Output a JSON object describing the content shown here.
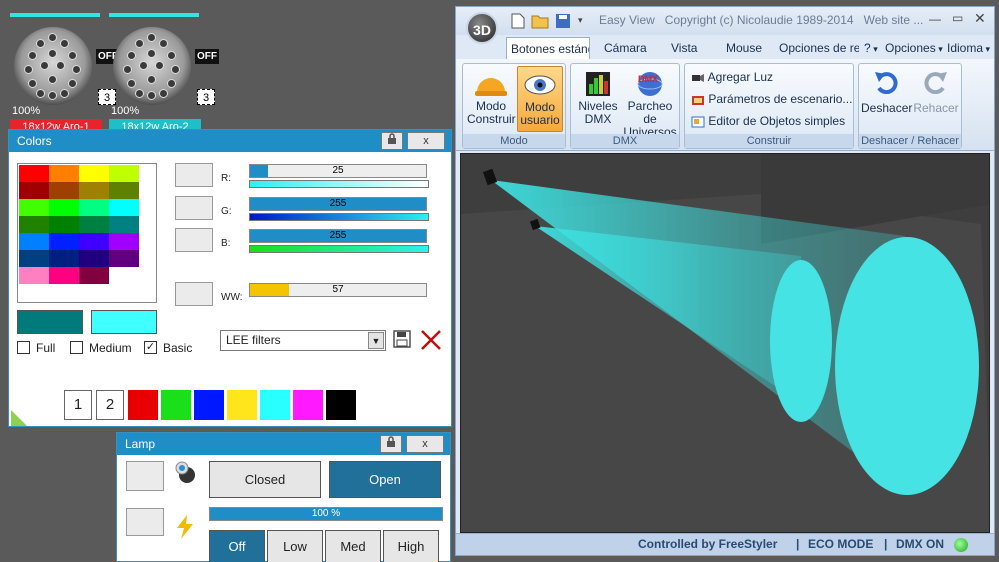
{
  "fixtures": [
    {
      "intensity": "100%",
      "off_label": "OFF",
      "number": "3",
      "name": "18x12w Aro-1",
      "name_color": "#e8232c"
    },
    {
      "intensity": "100%",
      "off_label": "OFF",
      "number": "3",
      "name": "18x12w Aro-2",
      "name_color": "#1fbfc9"
    }
  ],
  "colors_panel": {
    "title": "Colors",
    "lock_icon": "lock-icon",
    "close_label": "x",
    "palette": [
      [
        "#ff0000",
        "#ff8000",
        "#ffff00",
        "#c0ff00"
      ],
      [
        "#a00000",
        "#a04000",
        "#a08000",
        "#608000"
      ],
      [
        "#40ff00",
        "#00ff00",
        "#00ff80",
        "#00ffff"
      ],
      [
        "#208000",
        "#008000",
        "#008040",
        "#008080"
      ],
      [
        "#0080ff",
        "#0020ff",
        "#4000ff",
        "#a000ff"
      ],
      [
        "#004080",
        "#002080",
        "#200080",
        "#600080"
      ],
      [
        "#ff80c0",
        "#ff0080",
        "#800040",
        "#ffffff"
      ]
    ],
    "channels": [
      {
        "label": "R:",
        "value": "25",
        "level": 0.1,
        "grad": "linear-gradient(90deg,#2ef0f0,#ffffff)"
      },
      {
        "label": "G:",
        "value": "255",
        "level": 1.0,
        "grad": "linear-gradient(90deg,#0018c8,#2ef0f0)"
      },
      {
        "label": "B:",
        "value": "255",
        "level": 1.0,
        "grad": "linear-gradient(90deg,#18e018,#2ef0f0)"
      },
      {
        "label": "WW:",
        "value": "57",
        "level": 0.22,
        "grad": ""
      }
    ],
    "ww_fill_color": "#f5c400",
    "current_color_dark": "#007a7a",
    "current_color_light": "#40ffff",
    "filters_select": "LEE filters",
    "checkboxes": [
      {
        "label": "Full",
        "checked": false
      },
      {
        "label": "Medium",
        "checked": false
      },
      {
        "label": "Basic",
        "checked": true
      }
    ],
    "quick_numbers": [
      "1",
      "2"
    ],
    "quick_colors": [
      "#e80000",
      "#19e019",
      "#0018ff",
      "#ffe61c",
      "#29ffff",
      "#ff19ff",
      "#000000"
    ]
  },
  "lamp_panel": {
    "title": "Lamp",
    "close_label": "x",
    "shutter_closed": "Closed",
    "shutter_open": "Open",
    "dimmer_value": "100 %",
    "dimmer_level": 1.0,
    "modes": [
      "Off",
      "Low",
      "Med",
      "High"
    ]
  },
  "main_window": {
    "logo": "3D",
    "title": "Easy View   Copyright (c) Nicolaudie 1989-2014   Web site ...",
    "tabs": [
      "Botones estándar",
      "Cámara",
      "Vista",
      "Mouse",
      "Opciones de re",
      "?",
      "Opciones",
      "Idioma"
    ],
    "groups": [
      {
        "label": "Modo",
        "buttons": [
          {
            "line1": "Modo",
            "line2": "Construir"
          },
          {
            "line1": "Modo",
            "line2": "usuario"
          }
        ]
      },
      {
        "label": "DMX",
        "buttons": [
          {
            "line1": "Niveles",
            "line2": "DMX"
          },
          {
            "line1": "Parcheo de",
            "line2": "Universos"
          }
        ]
      },
      {
        "label": "Construir",
        "items": [
          "Agregar Luz",
          "Parámetros de escenario...",
          "Editor de Objetos simples"
        ]
      },
      {
        "label": "Deshacer / Rehacer",
        "buttons": [
          {
            "line1": "Deshacer",
            "line2": ""
          },
          {
            "line1": "Rehacer",
            "line2": ""
          }
        ]
      }
    ],
    "dmx_icon_text": "DMX",
    "status": {
      "left": "Controlled by FreeStyler",
      "eco": "ECO MODE",
      "dmx": "DMX ON"
    }
  }
}
